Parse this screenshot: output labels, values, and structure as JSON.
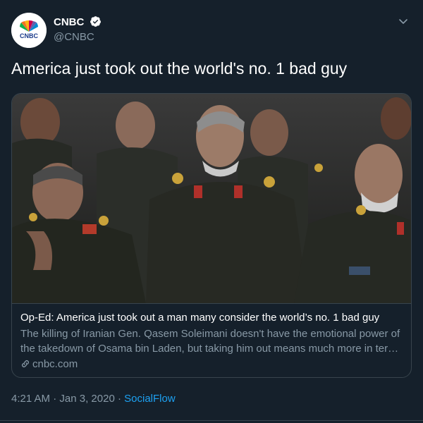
{
  "account": {
    "display_name": "CNBC",
    "handle": "@CNBC",
    "logo_text": "CNBC"
  },
  "tweet": {
    "text": "America just took out the world's no. 1 bad guy"
  },
  "card": {
    "title": "Op-Ed: America just took out a man many consider the world’s no. 1 bad guy",
    "description": "The killing of Iranian Gen. Qasem Soleimani doesn't have the emotional power of the takedown of Osama bin Laden, but taking him out means much more in terms of strategy and regional impact.",
    "domain": "cnbc.com"
  },
  "meta": {
    "time": "4:21 AM",
    "separator1": " · ",
    "date": "Jan 3, 2020",
    "separator2": " · ",
    "source": "SocialFlow"
  },
  "colors": {
    "background": "#15202b",
    "border": "#38444d",
    "secondary_text": "#8899a6",
    "link": "#1da1f2"
  },
  "icons": {
    "verified": "verified-badge-icon",
    "caret": "chevron-down-icon",
    "link": "link-icon"
  }
}
